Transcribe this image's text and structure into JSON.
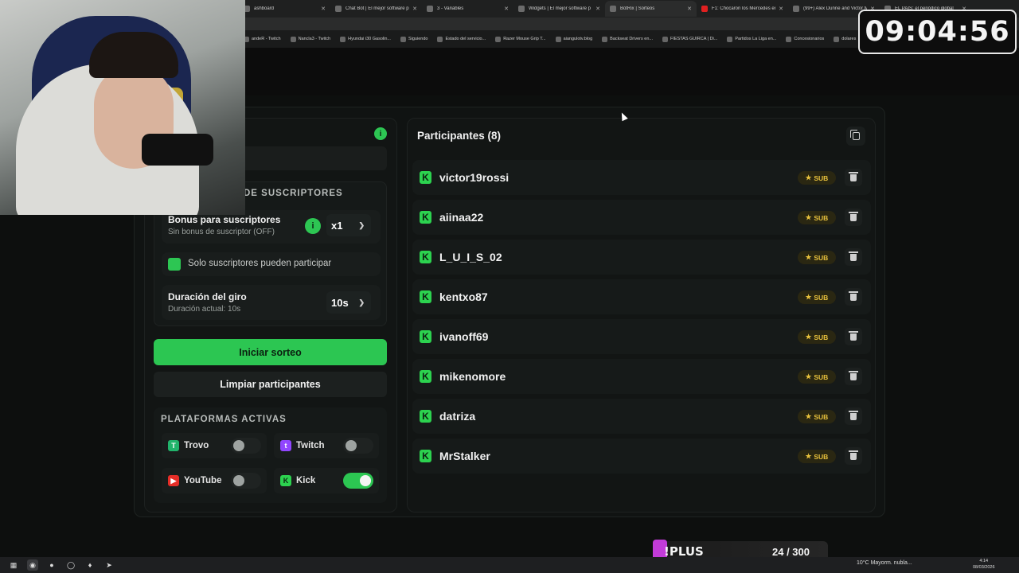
{
  "browser": {
    "tabs": [
      {
        "label": "ashboard",
        "color": "#6b6b6b"
      },
      {
        "label": "Chat Bot | El mejor software p",
        "color": "#6b6b6b"
      },
      {
        "label": "3 - Variables",
        "color": "#6b6b6b"
      },
      {
        "label": "Widgets | El mejor software p",
        "color": "#6b6b6b"
      },
      {
        "label": "BotRix | Sorteos",
        "color": "#6b6b6b",
        "active": true
      },
      {
        "label": "F1: Chocaron los Mercedes en",
        "color": "#e02020"
      },
      {
        "label": "(99+) Alex Dunne and Victor M",
        "color": "#6b6b6b"
      },
      {
        "label": "EL PAÍS: el periódico global",
        "color": "#6b6b6b"
      }
    ],
    "bookmarks": [
      "andeR - Twitch",
      "Nancla3 - Twitch",
      "Hyundai i30 Gasolin...",
      "Siguiendo",
      "Estado del servicio...",
      "Razer Mouse Grip T...",
      "aiangulotv.blog",
      "Backseat Drivers en...",
      "FIESTAS GUIRCA | Di...",
      "Partidos La Liga en...",
      "Concesionarios",
      "dolares"
    ]
  },
  "settings": {
    "info_icon": "i",
    "subscribers_heading": "DE SUSCRIPTORES",
    "bonus_title": "Bonus para suscriptores",
    "bonus_subtitle": "Sin bonus de suscriptor (OFF)",
    "bonus_info_icon": "i",
    "bonus_value": "x1",
    "subs_only_label": "Solo suscriptores pueden participar",
    "subs_only_checked": true,
    "duration_title": "Duración del giro",
    "duration_subtitle": "Duración actual: 10s",
    "duration_value": "10s",
    "start_button": "Iniciar sorteo",
    "clear_button": "Limpiar participantes"
  },
  "platforms": {
    "heading": "PLATAFORMAS ACTIVAS",
    "items": [
      {
        "name": "Trovo",
        "enabled": false,
        "color": "#21b36b"
      },
      {
        "name": "Twitch",
        "enabled": false,
        "color": "#9146ff"
      },
      {
        "name": "YouTube",
        "enabled": false,
        "color": "#e52d27"
      },
      {
        "name": "Kick",
        "enabled": true,
        "color": "#53fc18"
      }
    ]
  },
  "participants": {
    "title": "Participantes (8)",
    "badge_label": "SUB",
    "list": [
      "victor19rossi",
      "aiinaa22",
      "L_U_I_S_02",
      "kentxo87",
      "ivanoff69",
      "mikenomore",
      "datriza",
      "MrStalker"
    ]
  },
  "overlay": {
    "clock": "09:04:56",
    "plus_label": "!PLUS",
    "plus_count": "24 / 300"
  },
  "taskbar": {
    "weather": "10°C  Mayorm. nubla...",
    "time": "4:14",
    "date": "08/03/2026"
  },
  "colors": {
    "accent": "#2cc652",
    "sub_badge": "#e9c23c"
  }
}
